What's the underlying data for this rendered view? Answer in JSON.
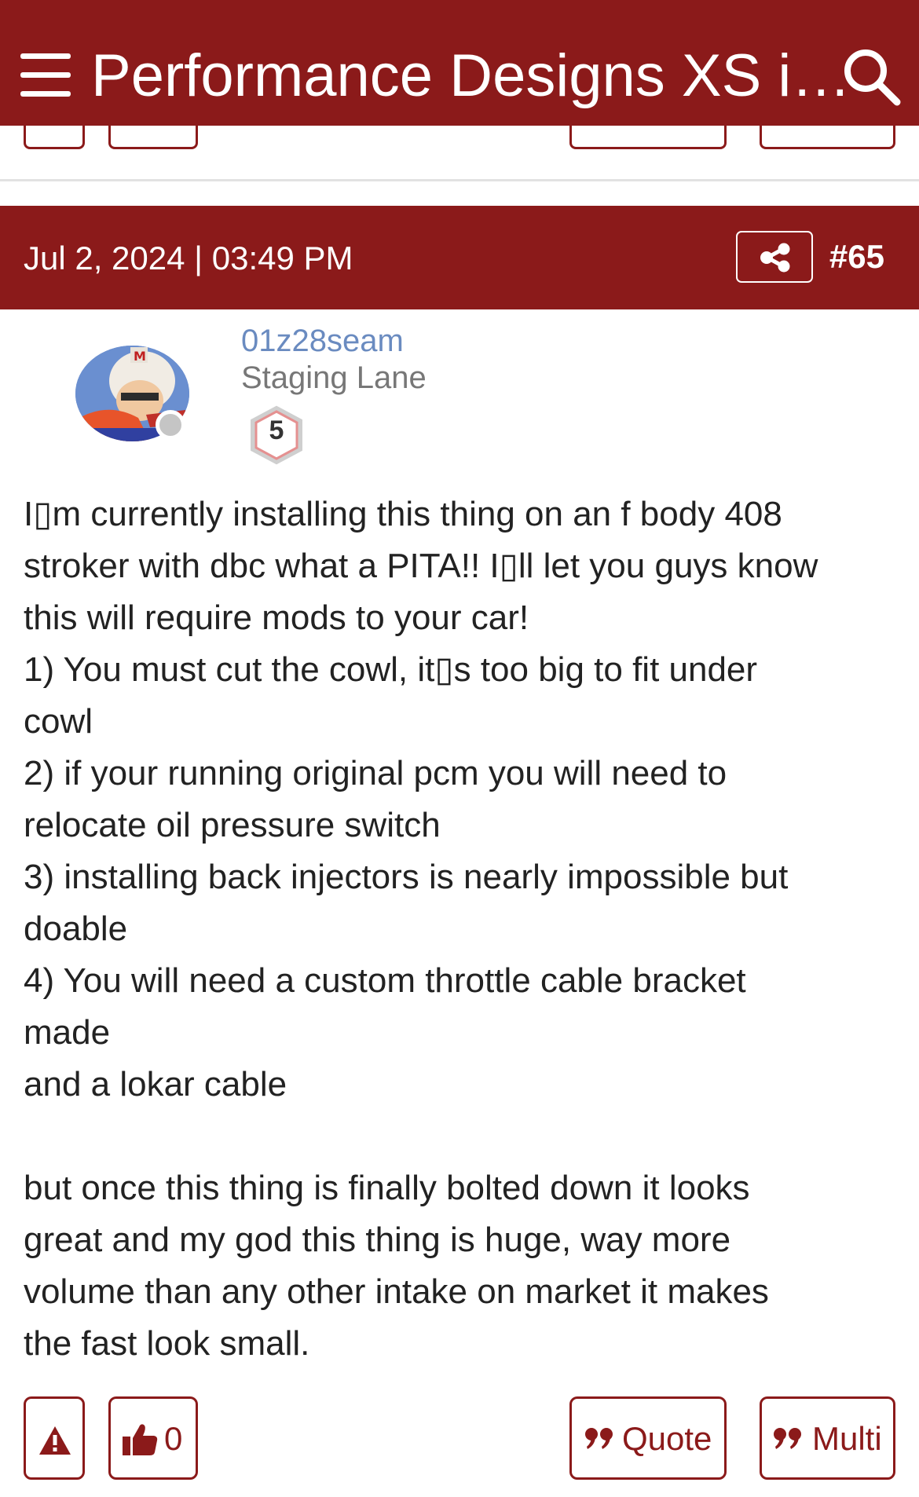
{
  "header": {
    "title": "Performance Designs XS i…"
  },
  "post": {
    "date": "Jul 2, 2024 | 03:49 PM",
    "number": "#65",
    "author": {
      "username": "01z28seam",
      "title": "Staging Lane",
      "rank": "5"
    },
    "body_lines": [
      "I▯m currently installing this thing on an f body 408",
      "stroker with dbc what a PITA!! I▯ll let you guys know",
      "this will require mods to your car!",
      "1) You must cut the cowl, it▯s too big to fit under",
      "cowl",
      "2) if your running original pcm you will need to",
      "relocate oil pressure switch",
      "3) installing back injectors is nearly impossible but",
      "doable",
      "4) You will need a custom throttle cable bracket",
      "made",
      "and a lokar cable",
      "",
      "but once this thing is finally bolted down it looks",
      "great and my god this thing is huge, way more",
      "volume than any other intake on market it makes",
      "the fast look small."
    ],
    "actions": {
      "like_count": "0",
      "quote_label": "Quote",
      "multi_label": "Multi"
    }
  },
  "colors": {
    "brand": "#8b1a1a",
    "username": "#6a8bc0"
  },
  "icons": [
    "menu-icon",
    "search-icon",
    "share-icon",
    "warning-icon",
    "thumbs-up-icon",
    "quote-icon"
  ]
}
